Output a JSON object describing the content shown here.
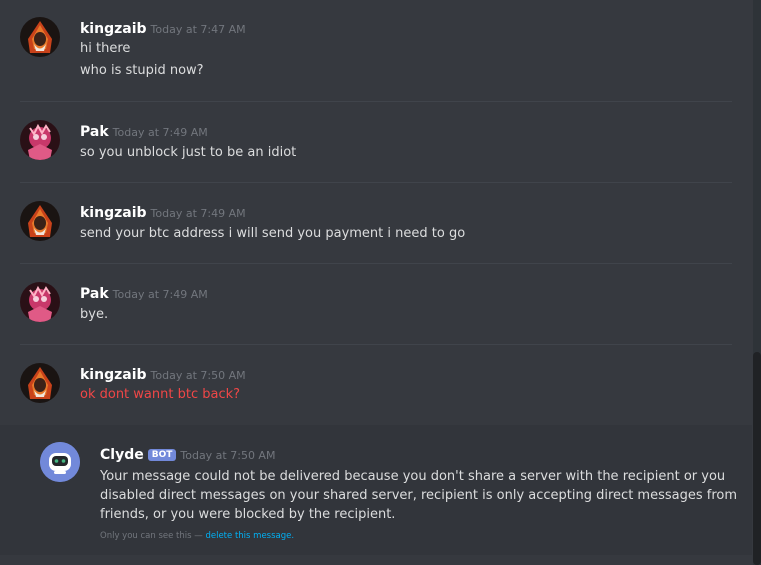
{
  "messages": [
    {
      "author": "kingzaib",
      "timestamp": "Today at 7:47 AM",
      "lines": [
        "hi there",
        "who is stupid now?"
      ]
    },
    {
      "author": "Pak",
      "timestamp": "Today at 7:49 AM",
      "lines": [
        "so you unblock just to be an idiot"
      ]
    },
    {
      "author": "kingzaib",
      "timestamp": "Today at 7:49 AM",
      "lines": [
        "send your btc address i will send you payment i need to go"
      ]
    },
    {
      "author": "Pak",
      "timestamp": "Today at 7:49 AM",
      "lines": [
        "bye."
      ]
    },
    {
      "author": "kingzaib",
      "timestamp": "Today at 7:50 AM",
      "lines": [
        "ok dont wannt btc back?"
      ],
      "error": true
    }
  ],
  "clyde": {
    "author": "Clyde",
    "badge": "BOT",
    "timestamp": "Today at 7:50 AM",
    "lines": [
      "Your message could not be delivered because you don't share a server with the recipient or you",
      "disabled direct messages on your shared server, recipient is only accepting direct messages from",
      "friends, or you were blocked by the recipient."
    ],
    "note_prefix": "Only you can see this —",
    "note_link": "delete this message."
  },
  "colors": {
    "background": "#36393f",
    "text": "#dcddde",
    "error": "#f04747",
    "blurple": "#7289da",
    "link": "#00b0f4"
  },
  "icons": {
    "kingzaib_avatar": "hooded-figure-avatar-icon",
    "pak_avatar": "anime-character-avatar-icon",
    "clyde_avatar": "clyde-robot-icon"
  }
}
